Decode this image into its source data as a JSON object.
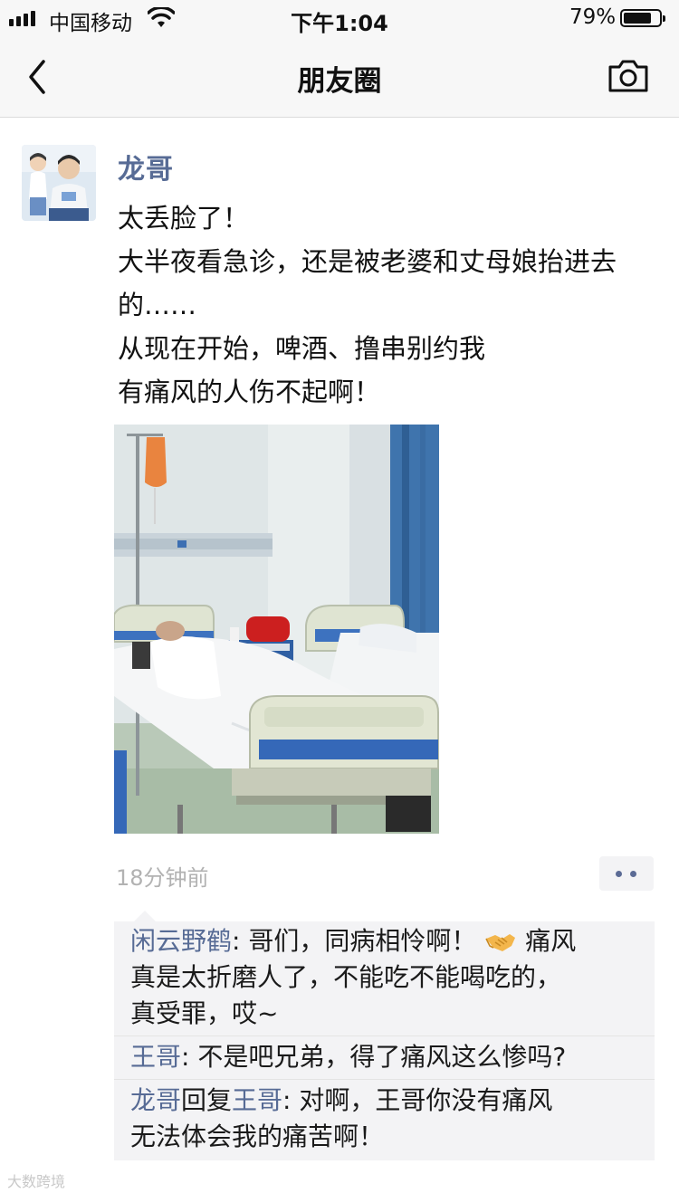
{
  "status_bar": {
    "carrier": "中国移动",
    "time": "下午1:04",
    "battery_percent": "79%",
    "battery_level": 0.79
  },
  "nav": {
    "title": "朋友圈",
    "back_icon": "chevron-left-icon",
    "camera_icon": "camera-icon"
  },
  "post": {
    "author": "龙哥",
    "text_lines": [
      "太丢脸了！",
      "大半夜看急诊，还是被老婆和丈母娘抬进去",
      "的……",
      "从现在开始，啤酒、撸串别约我",
      "有痛风的人伤不起啊！"
    ],
    "timestamp": "18分钟前"
  },
  "comments": [
    {
      "author": "闲云野鹤",
      "lines": [
        "哥们，同病相怜啊！",
        "痛风",
        "真是太折磨人了，不能吃不能喝吃的，",
        "真受罪，哎~"
      ]
    },
    {
      "author": "王哥",
      "text": "不是吧兄弟，得了痛风这么惨吗?"
    },
    {
      "author": "龙哥",
      "reply_word": "回复",
      "reply_to": "王哥",
      "lines": [
        "对啊，王哥你没有痛风",
        "无法体会我的痛苦啊！"
      ]
    }
  ],
  "watermark": "大数跨境",
  "colors": {
    "name_blue": "#576b95",
    "timestamp_gray": "#b2b2b2",
    "comment_bg": "#f3f3f5",
    "bar_bg": "#f7f7f7"
  }
}
